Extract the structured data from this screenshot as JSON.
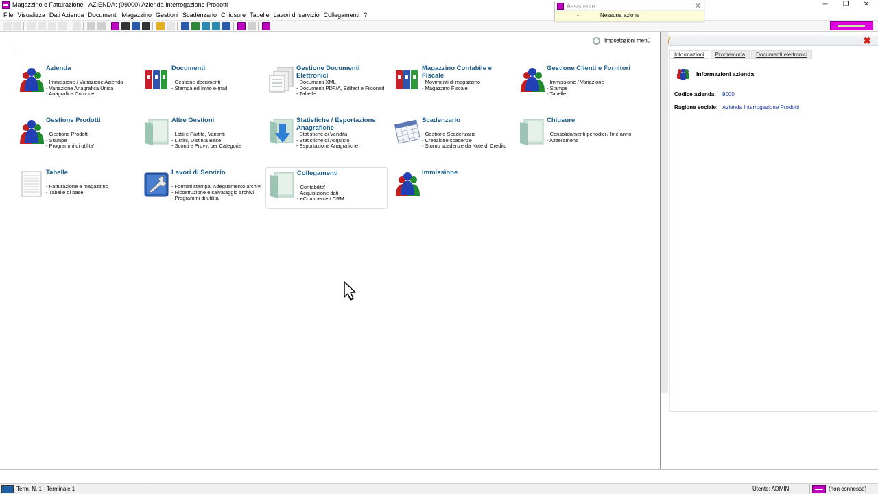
{
  "window": {
    "title": "Magazzino e Fatturazione - AZIENDA:  (09000) Azienda Interrogazione Prodotti",
    "minimize": "─",
    "restore": "❐",
    "close": "✕"
  },
  "menubar": [
    "File",
    "Visualizza",
    "Dati Azienda",
    "Documenti",
    "Magazzino",
    "Gestioni",
    "Scadenzario",
    "Chiusure",
    "Tabelle",
    "Lavori di servizio",
    "Collegamenti",
    "?"
  ],
  "assistant": {
    "title": "Assistente",
    "dash": "-",
    "status": "Nessuna azione",
    "close": "✕"
  },
  "main": {
    "menu_settings": "Impostazioni menù",
    "tiles": [
      {
        "title": "Azienda",
        "icon": "people-icon",
        "lines": [
          "- Immissione / Variazione Azienda",
          "- Variazione Anagrafica Unica",
          "- Anagrafica Comune"
        ]
      },
      {
        "title": "Documenti",
        "icon": "binders-icon",
        "lines": [
          "- Gestione documenti",
          "- Stampa ed Invio e-mail"
        ]
      },
      {
        "title": "Gestione Documenti Elettronici",
        "icon": "documents-icon",
        "lines": [
          "- Documenti XML",
          "- Documenti PDF/A, Edifact e Filconad",
          "- Tabelle"
        ]
      },
      {
        "title": "Magazzino Contabile e Fiscale",
        "icon": "binders-icon",
        "lines": [
          "- Movimenti di magazzino",
          "- Magazzino Fiscale"
        ]
      },
      {
        "title": "Gestione Clienti e Fornitori",
        "icon": "people-icon",
        "lines": [
          "- Immissione / Variazione",
          "- Stampe",
          "- Tabelle"
        ]
      },
      {
        "title": "Gestione Prodotti",
        "icon": "people-icon",
        "lines": [
          "- Gestione Prodotti",
          "- Stampe",
          "- Programmi di utilita'"
        ]
      },
      {
        "title": "Altre Gestioni",
        "icon": "folder-icon",
        "lines": [
          "- Lotti e Partite, Varianti",
          "- Listini, Distinta Base",
          "- Sconti e Provv. per Categorie"
        ]
      },
      {
        "title": "Statistiche / Esportazione Anagrafiche",
        "icon": "export-icon",
        "lines": [
          "- Statistiche di Vendita",
          "- Statistiche di Acquisto",
          "- Esportazione Anagrafiche"
        ]
      },
      {
        "title": "Scadenzario",
        "icon": "calendar-icon",
        "lines": [
          "- Gestione Scadenzario",
          "- Creazione scadenze",
          "- Storno scadenze da Note di Credito"
        ]
      },
      {
        "title": "Chiusure",
        "icon": "folder-icon",
        "lines": [
          "- Consolidamenti periodici / fine anno",
          "- Azzeramenti"
        ]
      },
      {
        "title": "Tabelle",
        "icon": "table-icon",
        "lines": [
          "- Fatturazione e magazzino",
          "- Tabelle di base"
        ]
      },
      {
        "title": "Lavori di Servizio",
        "icon": "wrench-icon",
        "lines": [
          "- Formati stampa, Adeguamento archivi",
          "- Ricostruzione e salvataggio archivi",
          "- Programmi di utilita'"
        ]
      },
      {
        "title": "Collegamenti",
        "icon": "folder-icon",
        "lines": [
          "- Contabilita'",
          "- Acquisizione dati",
          "- eCommerce / CRM"
        ]
      },
      {
        "title": "Immissione",
        "icon": "people-icon",
        "lines": []
      }
    ]
  },
  "side": {
    "tabs": [
      "Informazioni",
      "Promemoria",
      "Documenti elettronici"
    ],
    "info_title": "Informazioni azienda",
    "code_label": "Codice azienda:",
    "code_value": "9000",
    "name_label": "Ragione sociale:",
    "name_value": "Azienda Interrogazione Prodotti"
  },
  "statusbar": {
    "terminal": "Term. N. 1 - Terminale 1",
    "user": "Utente: ADMIN",
    "connection": "(non connesso)"
  }
}
